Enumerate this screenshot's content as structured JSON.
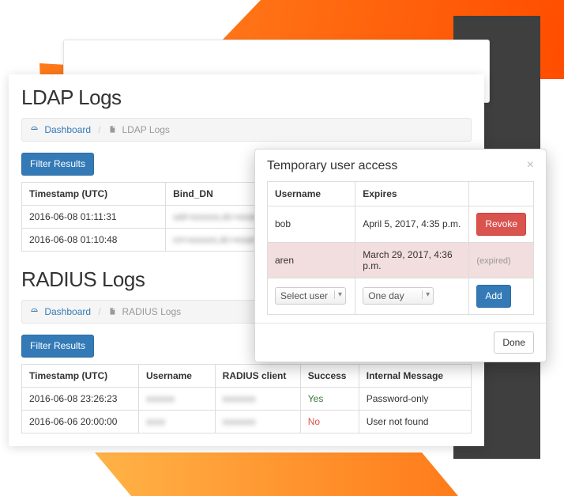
{
  "colors": {
    "primary": "#337ab7",
    "danger": "#d9534f",
    "success": "#3c763d",
    "orange_accent": "#ff7b1a",
    "dark_panel": "#3f3f3f"
  },
  "ldap": {
    "title": "LDAP Logs",
    "breadcrumb": {
      "dashboard_label": "Dashboard",
      "current": "LDAP Logs"
    },
    "filter_button": "Filter Results",
    "columns": [
      "Timestamp (UTC)",
      "Bind_DN"
    ],
    "rows": [
      {
        "timestamp": "2016-06-08 01:11:31",
        "bind_dn": "uid=xxxxxx,dc=example,dc=xxxxx"
      },
      {
        "timestamp": "2016-06-08 01:10:48",
        "bind_dn": "cn=xxxxxx,dc=example,dc=xxxxxxx"
      }
    ]
  },
  "radius": {
    "title": "RADIUS Logs",
    "breadcrumb": {
      "dashboard_label": "Dashboard",
      "current": "RADIUS Logs"
    },
    "filter_button": "Filter Results",
    "columns": [
      "Timestamp (UTC)",
      "Username",
      "RADIUS client",
      "Success",
      "Internal Message"
    ],
    "rows": [
      {
        "timestamp": "2016-06-08 23:26:23",
        "username": "xxxxxx",
        "client": "xxxxxxx",
        "success": "Yes",
        "message": "Password-only"
      },
      {
        "timestamp": "2016-06-06 20:00:00",
        "username": "xxxx",
        "client": "xxxxxxx",
        "success": "No",
        "message": "User not found"
      }
    ]
  },
  "modal": {
    "title": "Temporary user access",
    "close_label": "×",
    "columns": [
      "Username",
      "Expires",
      ""
    ],
    "rows": [
      {
        "username": "bob",
        "expires": "April 5, 2017, 4:35 p.m.",
        "action": "Revoke",
        "action_kind": "revoke"
      },
      {
        "username": "aren",
        "expires": "March 29, 2017, 4:36 p.m.",
        "action": "(expired)",
        "action_kind": "expired"
      }
    ],
    "select_user_placeholder": "Select user",
    "duration_value": "One day",
    "add_button": "Add",
    "done_button": "Done"
  }
}
